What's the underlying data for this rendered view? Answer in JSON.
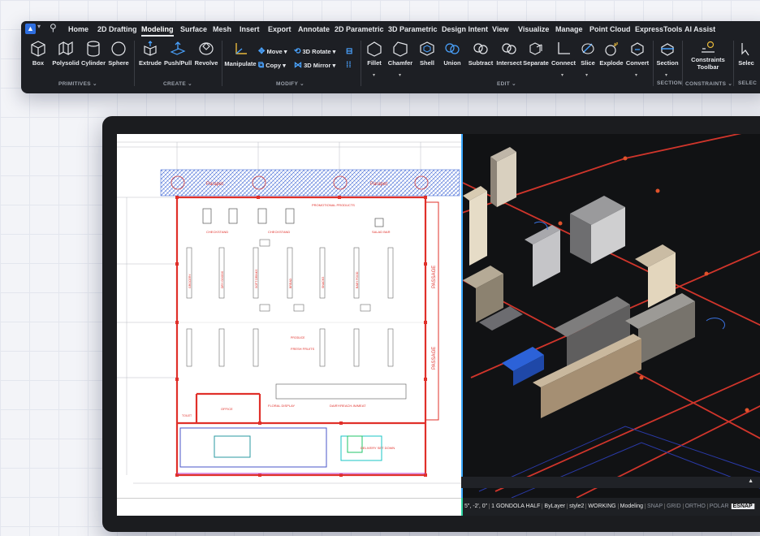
{
  "ribbon": {
    "tabs": [
      "Home",
      "2D Drafting",
      "Modeling",
      "Surface",
      "Mesh",
      "Insert",
      "Export",
      "Annotate",
      "2D Parametric",
      "3D Parametric",
      "Design Intent",
      "View",
      "Visualize",
      "Manage",
      "Point Cloud",
      "ExpressTools",
      "AI Assist"
    ],
    "active_tab": "Modeling",
    "primitives": {
      "box": "Box",
      "polysolid": "Polysolid",
      "cylinder": "Cylinder",
      "sphere": "Sphere"
    },
    "create": {
      "extrude": "Extrude",
      "pushpull": "Push/Pull",
      "revolve": "Revolve"
    },
    "modify": {
      "manipulate": "Manipulate",
      "move": "Move",
      "copy": "Copy",
      "rotate3d": "3D Rotate",
      "mirror3d": "3D Mirror"
    },
    "edit": {
      "fillet": "Fillet",
      "chamfer": "Chamfer",
      "shell": "Shell",
      "union": "Union",
      "subtract": "Subtract",
      "intersect": "Intersect",
      "separate": "Separate",
      "connect": "Connect",
      "slice": "Slice",
      "explode": "Explode",
      "convert": "Convert"
    },
    "section": {
      "section": "Section",
      "constraints_line1": "Constraints",
      "constraints_line2": "Toolbar",
      "select": "Selec"
    },
    "groups": {
      "primitives": "PRIMITIVES",
      "create": "CREATE",
      "modify": "MODIFY",
      "edit": "EDIT",
      "section": "SECTION",
      "constraints": "CONSTRAINTS",
      "select": "SELEC"
    }
  },
  "drawing": {
    "labels": {
      "parapet_left": "Parapet",
      "parapet_right": "Parapet",
      "checkstand1": "CHECKSTAND",
      "checkstand2": "CHECKSTAND",
      "promo": "PROMOTIONAL PRODUCTS",
      "salad_bar": "SALAD BAR",
      "passage1": "PASSAGE",
      "passage2": "PASSAGE",
      "produce": "PRODUCE",
      "fresh_fruits": "FRESH FRUITS",
      "floral": "FLORAL DISPLAY",
      "dairy": "DAIRY/REACH-IN/MEAT",
      "office": "OFFICE",
      "toilet": "TOILET",
      "delivery": "DELIVERY SET DOWN"
    }
  },
  "statusbar": {
    "coords": "5\", -2', 0\"",
    "layer": "1 GONDOLA HALF",
    "color": "ByLayer",
    "style": "style2",
    "state": "WORKING",
    "workspace": "Modeling",
    "snap": "SNAP",
    "grid": "GRID",
    "ortho": "ORTHO",
    "polar": "POLAR",
    "esnap": "ESNAP"
  },
  "colors": {
    "accent": "#2f6fe0",
    "red_wall": "#e0302a",
    "model_red": "#d0352b",
    "divider": "#3aa7ff"
  }
}
